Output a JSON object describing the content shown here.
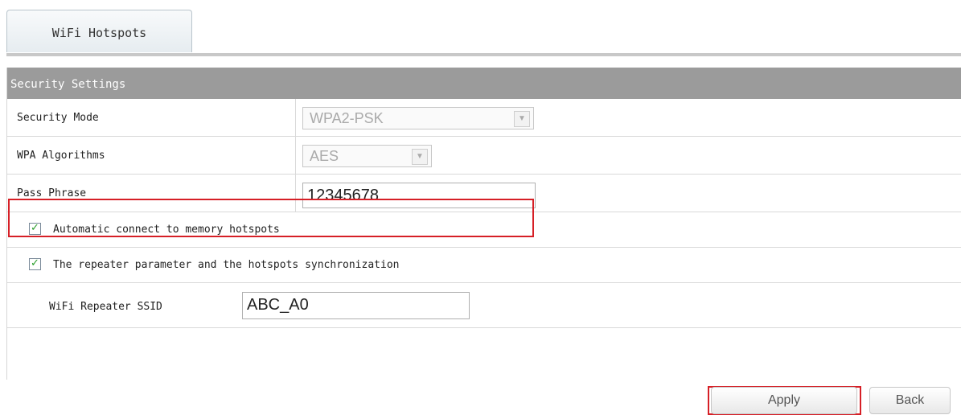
{
  "tabs": [
    {
      "label": "WiFi Hotspots",
      "active": true
    }
  ],
  "section": {
    "title": "Security Settings"
  },
  "fields": {
    "security_mode": {
      "label": "Security Mode",
      "value": "WPA2-PSK",
      "disabled": true
    },
    "wpa_algorithms": {
      "label": "WPA Algorithms",
      "value": "AES",
      "disabled": true
    },
    "pass_phrase": {
      "label": "Pass Phrase",
      "value": "12345678"
    }
  },
  "checkboxes": [
    {
      "label": "Automatic connect to memory hotspots",
      "checked": true
    },
    {
      "label": "The repeater parameter and the hotspots synchronization",
      "checked": true
    }
  ],
  "repeater": {
    "label": "WiFi Repeater SSID",
    "value": "ABC_A0"
  },
  "buttons": {
    "apply": "Apply",
    "back": "Back"
  },
  "icons": {
    "dropdown": "chevron-down-icon",
    "check": "checkmark-icon"
  },
  "colors": {
    "header_bg": "#9b9b9b",
    "highlight": "#d61f26",
    "check": "#2a9d2a"
  }
}
